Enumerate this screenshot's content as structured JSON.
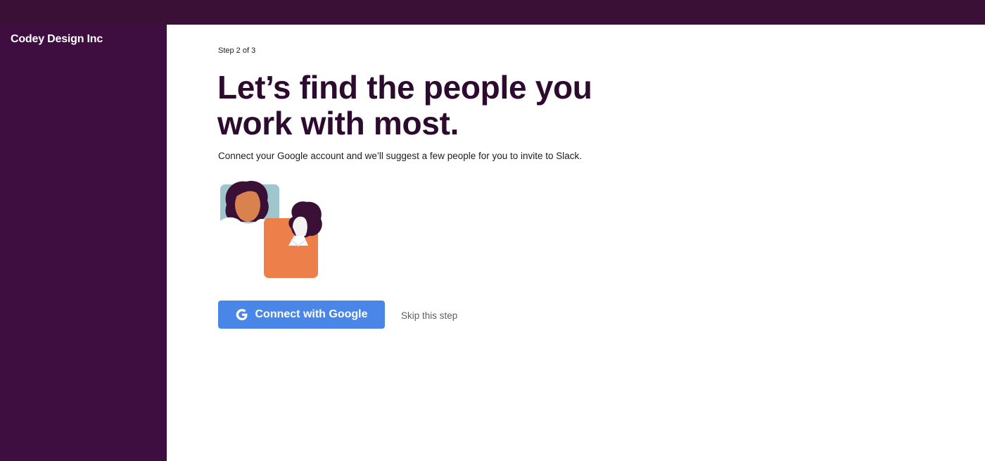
{
  "sidebar": {
    "workspace_name": "Codey Design Inc"
  },
  "main": {
    "step_label": "Step 2 of 3",
    "headline": "Let’s find the people you work with most.",
    "subtext": "Connect your Google account and we’ll suggest a few people for you to invite to Slack.",
    "connect_button_label": "Connect with Google",
    "skip_label": "Skip this step"
  },
  "colors": {
    "topbar": "#3a1037",
    "sidebar": "#3f0e40",
    "headline": "#2c0b2f",
    "google_button": "#4a86e8"
  },
  "icons": {
    "connect_button_icon": "google-g-icon"
  }
}
